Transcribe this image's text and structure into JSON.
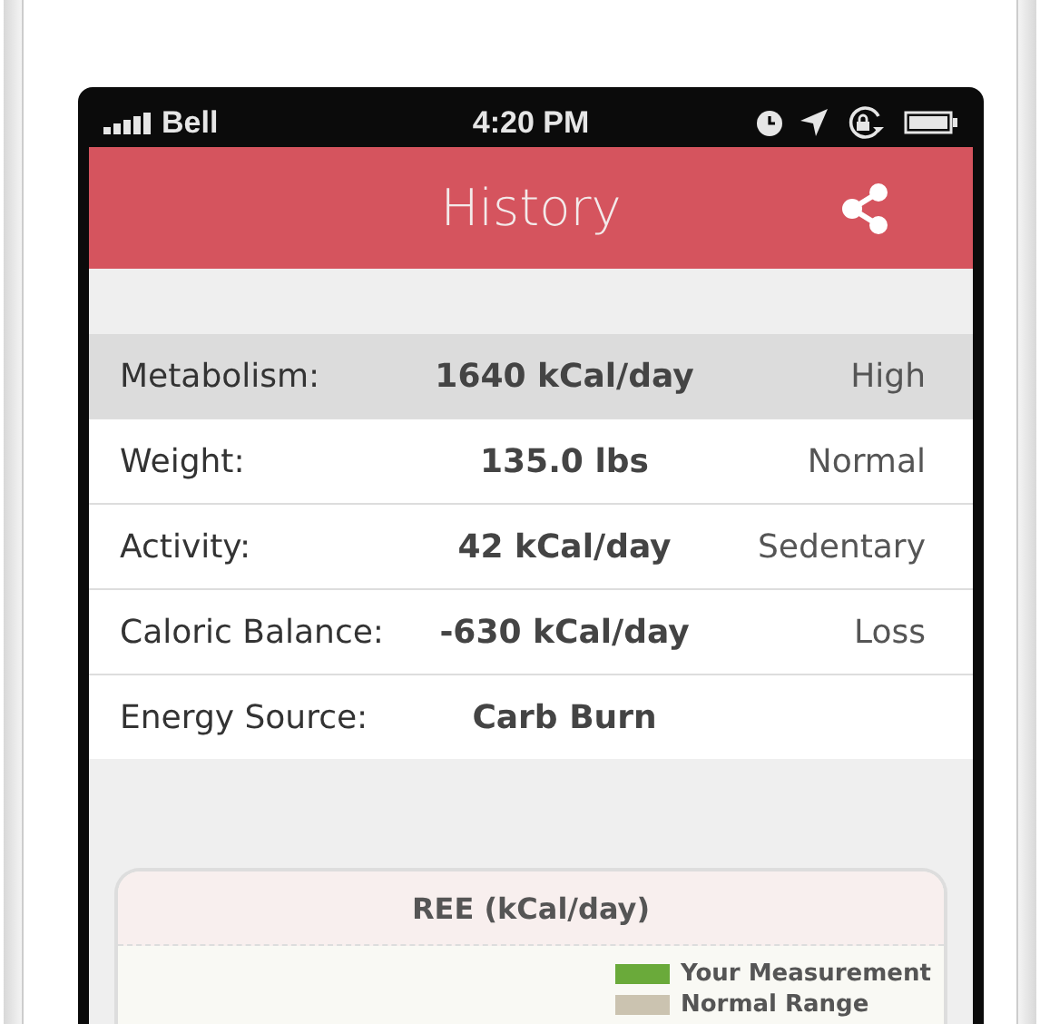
{
  "status_bar": {
    "carrier": "Bell",
    "time": "4:20 PM"
  },
  "header": {
    "title": "History"
  },
  "rows": [
    {
      "label": "Metabolism:",
      "value": "1640 kCal/day",
      "status": "High",
      "selected": true
    },
    {
      "label": "Weight:",
      "value": "135.0 lbs",
      "status": "Normal",
      "selected": false
    },
    {
      "label": "Activity:",
      "value": "42 kCal/day",
      "status": "Sedentary",
      "selected": false
    },
    {
      "label": "Caloric Balance:",
      "value": "-630 kCal/day",
      "status": "Loss",
      "selected": false
    },
    {
      "label": "Energy Source:",
      "value": "Carb Burn",
      "selected": false
    }
  ],
  "card": {
    "title": "REE (kCal/day)",
    "legend": [
      {
        "label": "Your Measurement",
        "color": "#6aaa3a"
      },
      {
        "label": "Normal Range",
        "color": "#cbc3b0"
      }
    ]
  }
}
